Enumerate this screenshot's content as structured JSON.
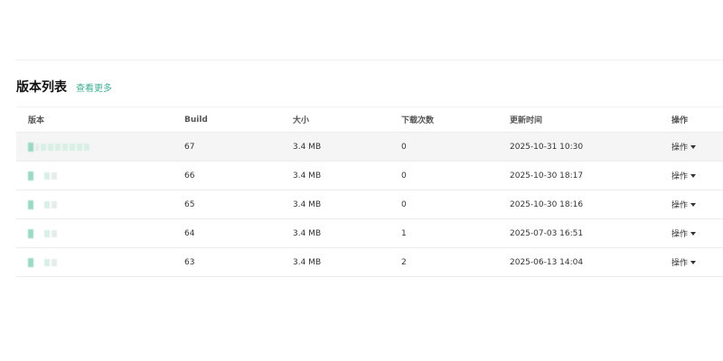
{
  "section": {
    "title": "版本列表",
    "view_more": "查看更多"
  },
  "table": {
    "headers": {
      "version": "版本",
      "build": "Build",
      "size": "大小",
      "downloads": "下载次数",
      "updated": "更新时间",
      "actions": "操作"
    },
    "rows": [
      {
        "build": "67",
        "size": "3.4 MB",
        "downloads": "0",
        "updated": "2025-10-31 10:30",
        "action": "操作"
      },
      {
        "build": "66",
        "size": "3.4 MB",
        "downloads": "0",
        "updated": "2025-10-30 18:17",
        "action": "操作"
      },
      {
        "build": "65",
        "size": "3.4 MB",
        "downloads": "0",
        "updated": "2025-10-30 18:16",
        "action": "操作"
      },
      {
        "build": "64",
        "size": "3.4 MB",
        "downloads": "1",
        "updated": "2025-07-03 16:51",
        "action": "操作"
      },
      {
        "build": "63",
        "size": "3.4 MB",
        "downloads": "2",
        "updated": "2025-06-13 14:04",
        "action": "操作"
      }
    ]
  },
  "colors": {
    "accent": "#3fae8f",
    "row_hover": "#f5f5f5",
    "divider": "#ececec"
  },
  "icons": {
    "action_caret": "caret-down-icon"
  }
}
